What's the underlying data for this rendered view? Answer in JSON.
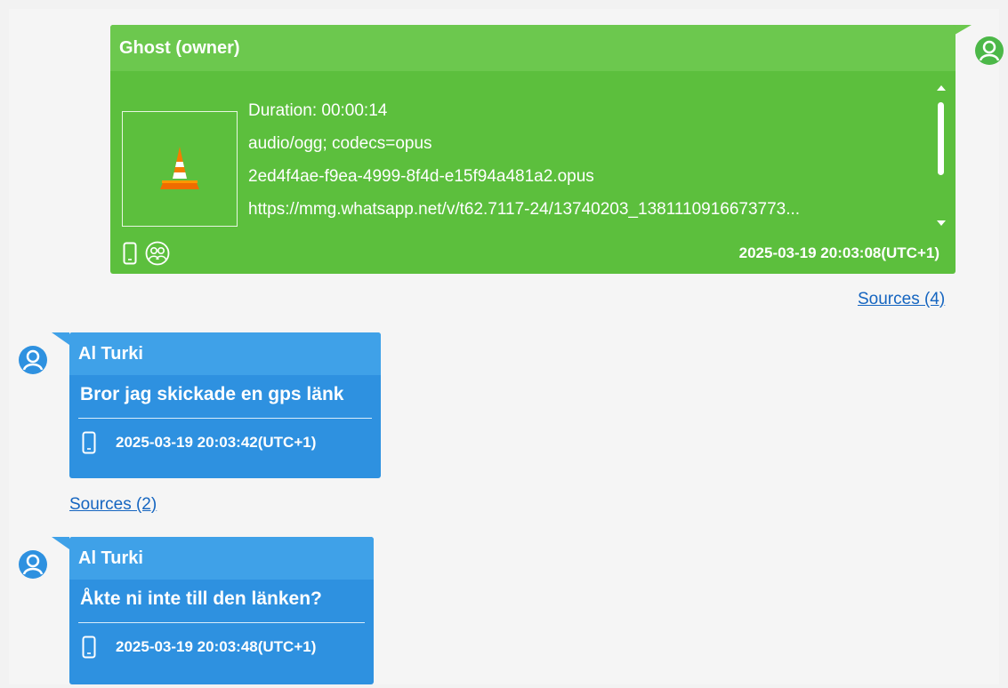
{
  "messages": {
    "owner": {
      "sender": "Ghost (owner)",
      "lines": [
        "Duration: 00:00:14",
        "audio/ogg; codecs=opus",
        "2ed4f4ae-f9ea-4999-8f4d-e15f94a481a2.opus",
        "https://mmg.whatsapp.net/v/t62.7117-24/13740203_1381110916673773..."
      ],
      "timestamp": "2025-03-19 20:03:08(UTC+1)",
      "sources": "Sources (4)",
      "attachment_icon": "vlc-cone-icon"
    },
    "incoming": [
      {
        "sender": "Al Turki",
        "text": "Bror jag skickade en gps länk",
        "timestamp": "2025-03-19 20:03:42(UTC+1)",
        "sources": "Sources (2)"
      },
      {
        "sender": "Al Turki",
        "text": "Åkte ni inte till den länken?",
        "timestamp": "2025-03-19 20:03:48(UTC+1)"
      }
    ]
  },
  "colors": {
    "owner_bubble": "#5cbf3d",
    "owner_header": "#6cc84e",
    "incoming_bubble": "#2e91e0",
    "incoming_header": "#3fa1e8",
    "link": "#1565c0",
    "avatar_owner": "#4cb848",
    "avatar_incoming": "#2e91e0"
  },
  "icons": [
    "user-avatar-icon",
    "phone-icon",
    "group-icon",
    "vlc-cone-icon"
  ]
}
